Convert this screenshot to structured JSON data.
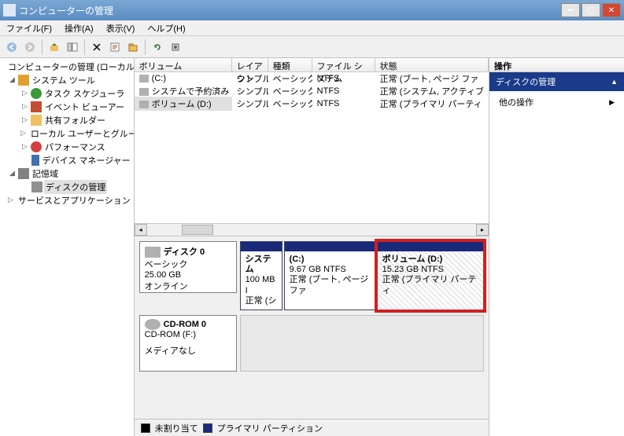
{
  "title": "コンピューターの管理",
  "menu": {
    "file": "ファイル(F)",
    "action": "操作(A)",
    "view": "表示(V)",
    "help": "ヘルプ(H)"
  },
  "tree": {
    "root": "コンピューターの管理 (ローカル)",
    "systools": "システム ツール",
    "tasksched": "タスク スケジューラ",
    "eventvwr": "イベント ビューアー",
    "shared": "共有フォルダー",
    "users": "ローカル ユーザーとグループ",
    "perf": "パフォーマンス",
    "devmgr": "デバイス マネージャー",
    "storage": "記憶域",
    "diskmgmt": "ディスクの管理",
    "services": "サービスとアプリケーション"
  },
  "columns": {
    "volume": "ボリューム",
    "layout": "レイアウト",
    "type": "種類",
    "fs": "ファイル システム",
    "status": "状態"
  },
  "rows": [
    {
      "vol": "(C:)",
      "layout": "シンプル",
      "type": "ベーシック",
      "fs": "NTFS",
      "status": "正常 (ブート, ページ ファ"
    },
    {
      "vol": "システムで予約済み",
      "layout": "シンプル",
      "type": "ベーシック",
      "fs": "NTFS",
      "status": "正常 (システム, アクティブ"
    },
    {
      "vol": "ボリューム (D:)",
      "layout": "シンプル",
      "type": "ベーシック",
      "fs": "NTFS",
      "status": "正常 (プライマリ パーティ"
    }
  ],
  "disk0": {
    "title": "ディスク 0",
    "type": "ベーシック",
    "size": "25.00 GB",
    "state": "オンライン",
    "p0": {
      "name": "システム",
      "size": "100 MB I",
      "status": "正常 (シ"
    },
    "p1": {
      "name": "(C:)",
      "size": "9.67 GB NTFS",
      "status": "正常 (ブート, ページ ファ"
    },
    "p2": {
      "name": "ボリューム (D:)",
      "size": "15.23 GB NTFS",
      "status": "正常 (プライマリ パーティ"
    }
  },
  "cdrom": {
    "title": "CD-ROM 0",
    "sub": "CD-ROM (F:)",
    "state": "メディアなし"
  },
  "legend": {
    "unalloc": "未割り当て",
    "primary": "プライマリ パーティション"
  },
  "actions": {
    "head": "操作",
    "section": "ディスクの管理",
    "more": "他の操作"
  }
}
